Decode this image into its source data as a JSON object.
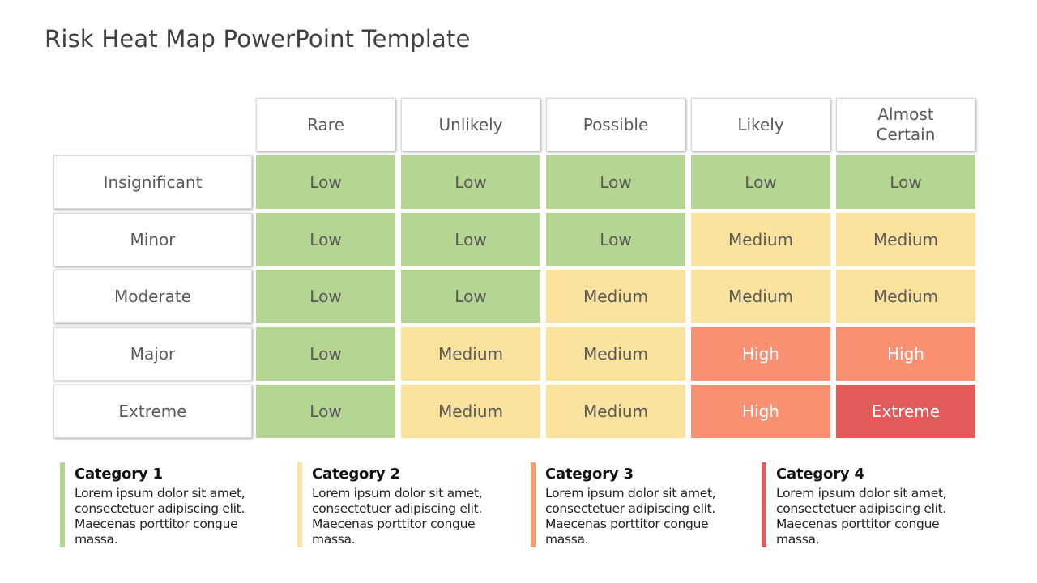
{
  "title": "Risk Heat Map PowerPoint Template",
  "colors": {
    "Low": "#b5d692",
    "Medium": "#fbe29d",
    "High": "#f99072",
    "Extreme": "#e15b5b",
    "text_dark": "#595959",
    "text_light": "#ffffff"
  },
  "likelihood_headers": [
    "Rare",
    "Unlikely",
    "Possible",
    "Likely",
    "Almost\nCertain"
  ],
  "impact_rows": [
    {
      "label": "Insignificant",
      "cells": [
        "Low",
        "Low",
        "Low",
        "Low",
        "Low"
      ]
    },
    {
      "label": "Minor",
      "cells": [
        "Low",
        "Low",
        "Low",
        "Medium",
        "Medium"
      ]
    },
    {
      "label": "Moderate",
      "cells": [
        "Low",
        "Low",
        "Medium",
        "Medium",
        "Medium"
      ]
    },
    {
      "label": "Major",
      "cells": [
        "Low",
        "Medium",
        "Medium",
        "High",
        "High"
      ]
    },
    {
      "label": "Extreme",
      "cells": [
        "Low",
        "Medium",
        "Medium",
        "High",
        "Extreme"
      ]
    }
  ],
  "categories": [
    {
      "title": "Category 1",
      "body": "Lorem ipsum dolor sit amet,\nconsectetuer adipiscing elit.\nMaecenas porttitor congue\nmassa.",
      "color": "#b5d692"
    },
    {
      "title": "Category 2",
      "body": "Lorem ipsum dolor sit amet,\nconsectetuer adipiscing elit.\nMaecenas porttitor congue\nmassa.",
      "color": "#fbe29d"
    },
    {
      "title": "Category 3",
      "body": "Lorem ipsum dolor sit amet,\nconsectetuer adipiscing elit.\nMaecenas porttitor congue\nmassa.",
      "color": "#f99d6a"
    },
    {
      "title": "Category 4",
      "body": "Lorem ipsum dolor sit amet,\nconsectetuer adipiscing elit.\nMaecenas porttitor congue\nmassa.",
      "color": "#e15b5b"
    }
  ]
}
